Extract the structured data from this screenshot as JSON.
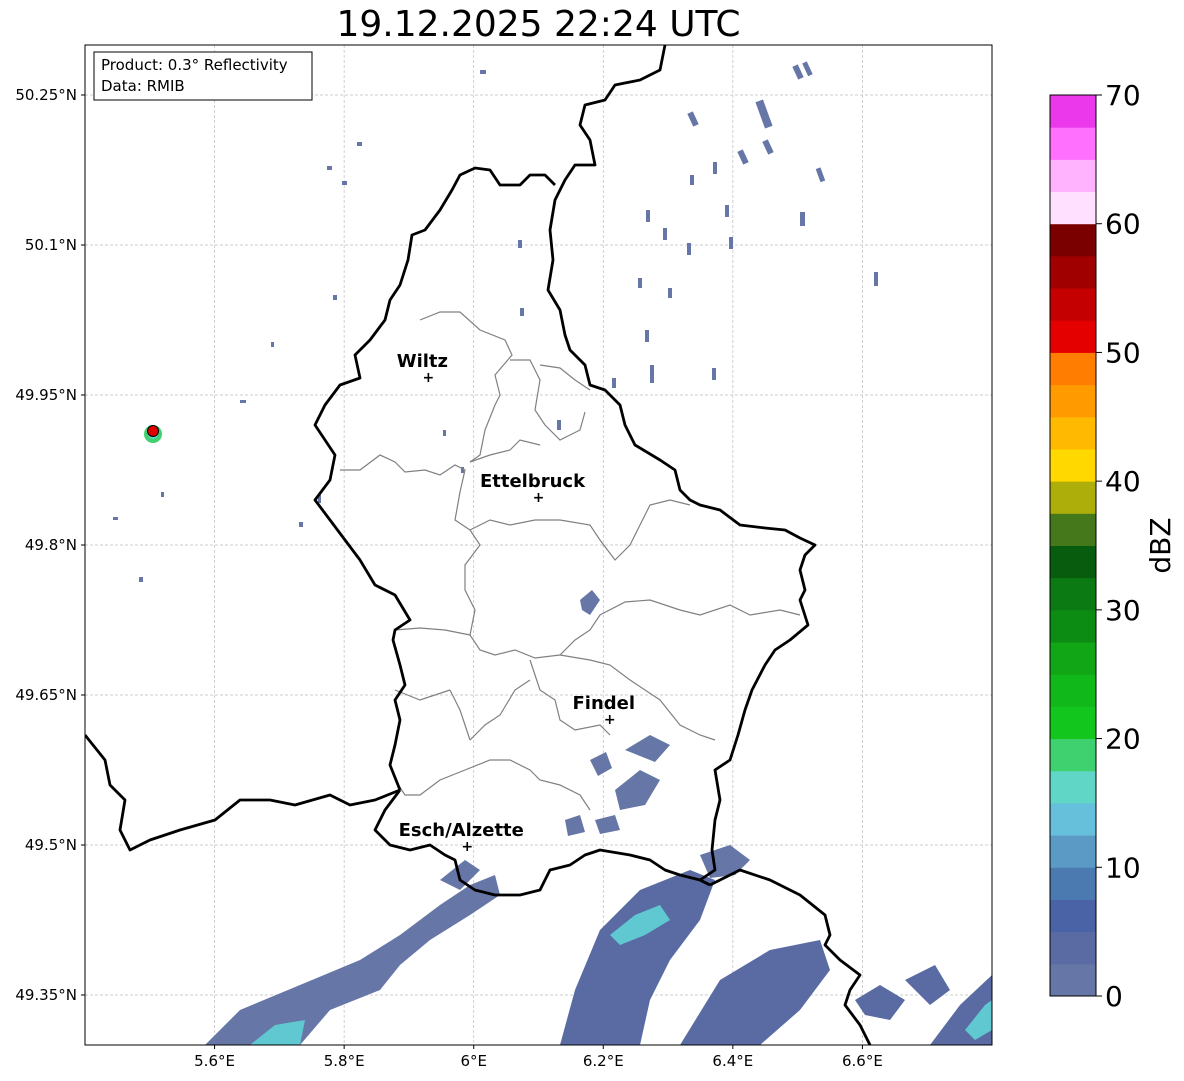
{
  "title": "19.12.2025 22:24 UTC",
  "info_box": {
    "line1": "Product: 0.3° Reflectivity",
    "line2": "Data: RMIB"
  },
  "map": {
    "extent": {
      "lon_min": 5.4,
      "lon_max": 6.8,
      "lat_min": 49.3,
      "lat_max": 50.3
    },
    "lon_ticks": [
      {
        "value": 5.6,
        "label": "5.6°E"
      },
      {
        "value": 5.8,
        "label": "5.8°E"
      },
      {
        "value": 6.0,
        "label": "6°E"
      },
      {
        "value": 6.2,
        "label": "6.2°E"
      },
      {
        "value": 6.4,
        "label": "6.4°E"
      },
      {
        "value": 6.6,
        "label": "6.6°E"
      }
    ],
    "lat_ticks": [
      {
        "value": 50.25,
        "label": "50.25°N"
      },
      {
        "value": 50.1,
        "label": "50.1°N"
      },
      {
        "value": 49.95,
        "label": "49.95°N"
      },
      {
        "value": 49.8,
        "label": "49.8°N"
      },
      {
        "value": 49.65,
        "label": "49.65°N"
      },
      {
        "value": 49.5,
        "label": "49.5°N"
      },
      {
        "value": 49.35,
        "label": "49.35°N"
      }
    ],
    "cities": [
      {
        "name": "Wiltz",
        "lon": 5.93,
        "lat": 49.968
      },
      {
        "name": "Ettelbruck",
        "lon": 6.1,
        "lat": 49.848
      },
      {
        "name": "Findel",
        "lon": 6.21,
        "lat": 49.626
      },
      {
        "name": "Esch/Alzette",
        "lon": 5.99,
        "lat": 49.499
      }
    ],
    "radar_site": {
      "lon": 5.505,
      "lat": 49.914,
      "color": "#e00000"
    },
    "border_color": "#000000",
    "canton_color": "#808080"
  },
  "colorbar": {
    "label": "dBZ",
    "min": 0,
    "max": 70,
    "step": 2.5,
    "ticks": [
      {
        "value": 0,
        "label": "0"
      },
      {
        "value": 10,
        "label": "10"
      },
      {
        "value": 20,
        "label": "20"
      },
      {
        "value": 30,
        "label": "30"
      },
      {
        "value": 40,
        "label": "40"
      },
      {
        "value": 50,
        "label": "50"
      },
      {
        "value": 60,
        "label": "60"
      },
      {
        "value": 70,
        "label": "70"
      }
    ],
    "colors": [
      "#6676a6",
      "#5a6ba3",
      "#4a62a6",
      "#4b7ab1",
      "#5a9ac4",
      "#66bfdb",
      "#60d6c6",
      "#3fd170",
      "#12c61d",
      "#10b81a",
      "#10a616",
      "#0d8c14",
      "#0c7a12",
      "#075c0d",
      "#44781a",
      "#adae0a",
      "#ffd800",
      "#ffb900",
      "#ff9a00",
      "#ff7d00",
      "#e50000",
      "#c40000",
      "#a10000",
      "#7a0000",
      "#ffe0ff",
      "#ffb3ff",
      "#ff70ff",
      "#ea38ea"
    ]
  }
}
